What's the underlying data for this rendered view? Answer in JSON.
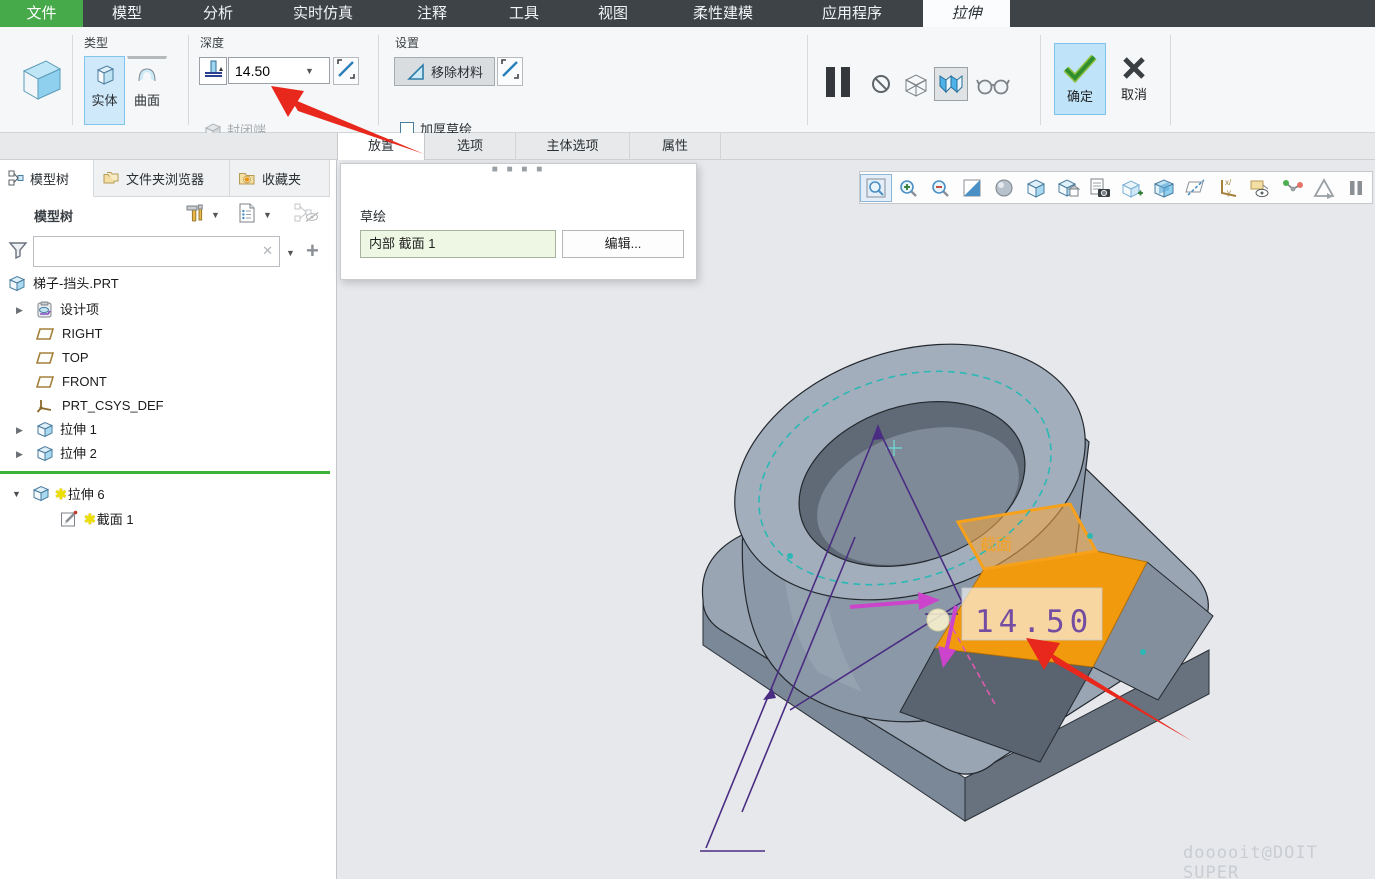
{
  "menu": {
    "items": [
      {
        "label": "文件"
      },
      {
        "label": "模型"
      },
      {
        "label": "分析"
      },
      {
        "label": "实时仿真"
      },
      {
        "label": "注释"
      },
      {
        "label": "工具"
      },
      {
        "label": "视图"
      },
      {
        "label": "柔性建模"
      },
      {
        "label": "应用程序"
      },
      {
        "label": "拉伸"
      }
    ]
  },
  "ribbon": {
    "type_group": {
      "label": "类型",
      "solid": "实体",
      "surface": "曲面"
    },
    "depth_group": {
      "label": "深度",
      "value": "14.50",
      "closed_end": "封闭端"
    },
    "settings_group": {
      "label": "设置",
      "remove_material": "移除材料",
      "thicken_sketch": "加厚草绘"
    },
    "commands": {
      "ok": "确定",
      "cancel": "取消"
    }
  },
  "dashboard_tabs": {
    "placement": "放置",
    "options": "选项",
    "body_options": "主体选项",
    "properties": "属性"
  },
  "placement_panel": {
    "sketch_label": "草绘",
    "sketch_value": "内部 截面 1",
    "edit_button": "编辑..."
  },
  "navigator": {
    "tabs": {
      "model_tree": "模型树",
      "folder_browser": "文件夹浏览器",
      "favorites": "收藏夹"
    },
    "header": "模型树",
    "tree": [
      {
        "label": "梯子-挡头.PRT"
      },
      {
        "label": "设计项"
      },
      {
        "label": "RIGHT"
      },
      {
        "label": "TOP"
      },
      {
        "label": "FRONT"
      },
      {
        "label": "PRT_CSYS_DEF"
      },
      {
        "label": "拉伸 1"
      },
      {
        "label": "拉伸 2"
      },
      {
        "label": "拉伸 6"
      },
      {
        "label": "截面 1"
      }
    ]
  },
  "viewport": {
    "dimension_value": "14.50",
    "section_label": "截面",
    "watermark": "dooooit@DOIT SUPER"
  },
  "colors": {
    "menu_bar": "#3d4347",
    "file_tab_green": "#46a94a",
    "selection_blue": "#cfe9fa",
    "insert_line_green": "#3cb43c",
    "highlight_orange": "#f5a01a",
    "dimension_purple": "#5e35a1",
    "annotation_red": "#e8271d",
    "model_gray": "#8b98a7"
  }
}
